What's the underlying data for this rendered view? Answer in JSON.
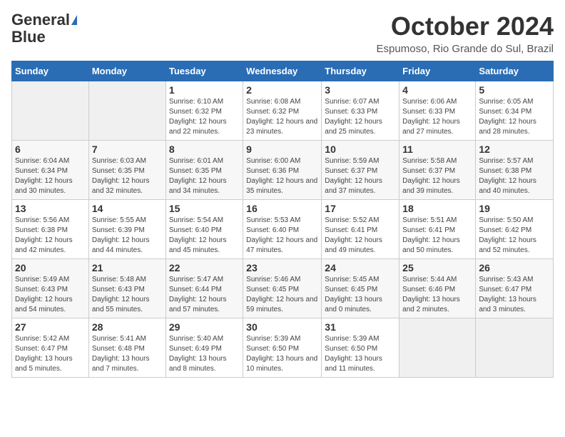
{
  "header": {
    "logo_line1": "General",
    "logo_line2": "Blue",
    "month": "October 2024",
    "location": "Espumoso, Rio Grande do Sul, Brazil"
  },
  "days_of_week": [
    "Sunday",
    "Monday",
    "Tuesday",
    "Wednesday",
    "Thursday",
    "Friday",
    "Saturday"
  ],
  "weeks": [
    [
      {
        "num": "",
        "detail": ""
      },
      {
        "num": "",
        "detail": ""
      },
      {
        "num": "1",
        "detail": "Sunrise: 6:10 AM\nSunset: 6:32 PM\nDaylight: 12 hours and 22 minutes."
      },
      {
        "num": "2",
        "detail": "Sunrise: 6:08 AM\nSunset: 6:32 PM\nDaylight: 12 hours and 23 minutes."
      },
      {
        "num": "3",
        "detail": "Sunrise: 6:07 AM\nSunset: 6:33 PM\nDaylight: 12 hours and 25 minutes."
      },
      {
        "num": "4",
        "detail": "Sunrise: 6:06 AM\nSunset: 6:33 PM\nDaylight: 12 hours and 27 minutes."
      },
      {
        "num": "5",
        "detail": "Sunrise: 6:05 AM\nSunset: 6:34 PM\nDaylight: 12 hours and 28 minutes."
      }
    ],
    [
      {
        "num": "6",
        "detail": "Sunrise: 6:04 AM\nSunset: 6:34 PM\nDaylight: 12 hours and 30 minutes."
      },
      {
        "num": "7",
        "detail": "Sunrise: 6:03 AM\nSunset: 6:35 PM\nDaylight: 12 hours and 32 minutes."
      },
      {
        "num": "8",
        "detail": "Sunrise: 6:01 AM\nSunset: 6:35 PM\nDaylight: 12 hours and 34 minutes."
      },
      {
        "num": "9",
        "detail": "Sunrise: 6:00 AM\nSunset: 6:36 PM\nDaylight: 12 hours and 35 minutes."
      },
      {
        "num": "10",
        "detail": "Sunrise: 5:59 AM\nSunset: 6:37 PM\nDaylight: 12 hours and 37 minutes."
      },
      {
        "num": "11",
        "detail": "Sunrise: 5:58 AM\nSunset: 6:37 PM\nDaylight: 12 hours and 39 minutes."
      },
      {
        "num": "12",
        "detail": "Sunrise: 5:57 AM\nSunset: 6:38 PM\nDaylight: 12 hours and 40 minutes."
      }
    ],
    [
      {
        "num": "13",
        "detail": "Sunrise: 5:56 AM\nSunset: 6:38 PM\nDaylight: 12 hours and 42 minutes."
      },
      {
        "num": "14",
        "detail": "Sunrise: 5:55 AM\nSunset: 6:39 PM\nDaylight: 12 hours and 44 minutes."
      },
      {
        "num": "15",
        "detail": "Sunrise: 5:54 AM\nSunset: 6:40 PM\nDaylight: 12 hours and 45 minutes."
      },
      {
        "num": "16",
        "detail": "Sunrise: 5:53 AM\nSunset: 6:40 PM\nDaylight: 12 hours and 47 minutes."
      },
      {
        "num": "17",
        "detail": "Sunrise: 5:52 AM\nSunset: 6:41 PM\nDaylight: 12 hours and 49 minutes."
      },
      {
        "num": "18",
        "detail": "Sunrise: 5:51 AM\nSunset: 6:41 PM\nDaylight: 12 hours and 50 minutes."
      },
      {
        "num": "19",
        "detail": "Sunrise: 5:50 AM\nSunset: 6:42 PM\nDaylight: 12 hours and 52 minutes."
      }
    ],
    [
      {
        "num": "20",
        "detail": "Sunrise: 5:49 AM\nSunset: 6:43 PM\nDaylight: 12 hours and 54 minutes."
      },
      {
        "num": "21",
        "detail": "Sunrise: 5:48 AM\nSunset: 6:43 PM\nDaylight: 12 hours and 55 minutes."
      },
      {
        "num": "22",
        "detail": "Sunrise: 5:47 AM\nSunset: 6:44 PM\nDaylight: 12 hours and 57 minutes."
      },
      {
        "num": "23",
        "detail": "Sunrise: 5:46 AM\nSunset: 6:45 PM\nDaylight: 12 hours and 59 minutes."
      },
      {
        "num": "24",
        "detail": "Sunrise: 5:45 AM\nSunset: 6:45 PM\nDaylight: 13 hours and 0 minutes."
      },
      {
        "num": "25",
        "detail": "Sunrise: 5:44 AM\nSunset: 6:46 PM\nDaylight: 13 hours and 2 minutes."
      },
      {
        "num": "26",
        "detail": "Sunrise: 5:43 AM\nSunset: 6:47 PM\nDaylight: 13 hours and 3 minutes."
      }
    ],
    [
      {
        "num": "27",
        "detail": "Sunrise: 5:42 AM\nSunset: 6:47 PM\nDaylight: 13 hours and 5 minutes."
      },
      {
        "num": "28",
        "detail": "Sunrise: 5:41 AM\nSunset: 6:48 PM\nDaylight: 13 hours and 7 minutes."
      },
      {
        "num": "29",
        "detail": "Sunrise: 5:40 AM\nSunset: 6:49 PM\nDaylight: 13 hours and 8 minutes."
      },
      {
        "num": "30",
        "detail": "Sunrise: 5:39 AM\nSunset: 6:50 PM\nDaylight: 13 hours and 10 minutes."
      },
      {
        "num": "31",
        "detail": "Sunrise: 5:39 AM\nSunset: 6:50 PM\nDaylight: 13 hours and 11 minutes."
      },
      {
        "num": "",
        "detail": ""
      },
      {
        "num": "",
        "detail": ""
      }
    ]
  ]
}
